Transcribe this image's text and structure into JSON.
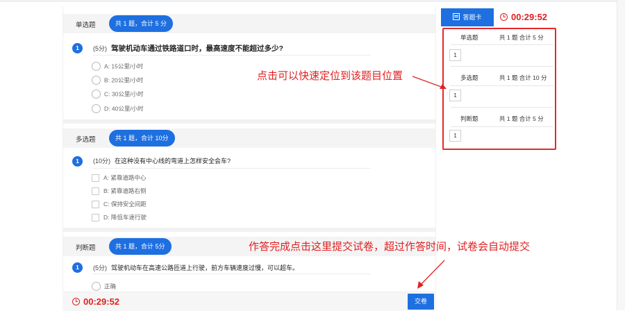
{
  "sections": [
    {
      "title": "单选题",
      "summary": "共 1 题，合计 5 分",
      "question": {
        "number": "1",
        "score": "(5分)",
        "text": "驾驶机动车通过铁路道口时，最高速度不能超过多少?",
        "options": [
          "A:  15公里/小时",
          "B:  20公里/小时",
          "C:  30公里/小时",
          "D:  40公里/小时"
        ]
      }
    },
    {
      "title": "多选题",
      "summary": "共 1 题，合计 10分",
      "question": {
        "number": "1",
        "score": "(10分)",
        "text": "在这种没有中心线的弯道上怎样安全会车?",
        "options": [
          "A:  紧靠道路中心",
          "B:  紧靠道路右侧",
          "C:  保持安全间距",
          "D:  降低车速行驶"
        ]
      }
    },
    {
      "title": "判断题",
      "summary": "共 1 题，合计 5分",
      "question": {
        "number": "1",
        "score": "(5分)",
        "text": "驾驶机动车在高速公路匝道上行驶，前方车辆速度过慢，可以超车。",
        "options": [
          "正确"
        ]
      }
    }
  ],
  "timer": "00:29:52",
  "submit_label": "交卷",
  "answer_card": {
    "label": "答题卡",
    "groups": [
      {
        "name": "单选题",
        "info": "共 1 题 合计 5 分",
        "items": [
          "1"
        ]
      },
      {
        "name": "多选题",
        "info": "共 1 题 合计 10 分",
        "items": [
          "1"
        ]
      },
      {
        "name": "判断题",
        "info": "共 1 题 合计 5 分",
        "items": [
          "1"
        ]
      }
    ]
  },
  "annotations": {
    "locate_hint": "点击可以快速定位到该题目位置",
    "submit_hint": "作答完成点击这里提交试卷，超过作答时间，试卷会自动提交"
  },
  "colors": {
    "accent": "#1e6fe0",
    "alert": "#e02020"
  }
}
